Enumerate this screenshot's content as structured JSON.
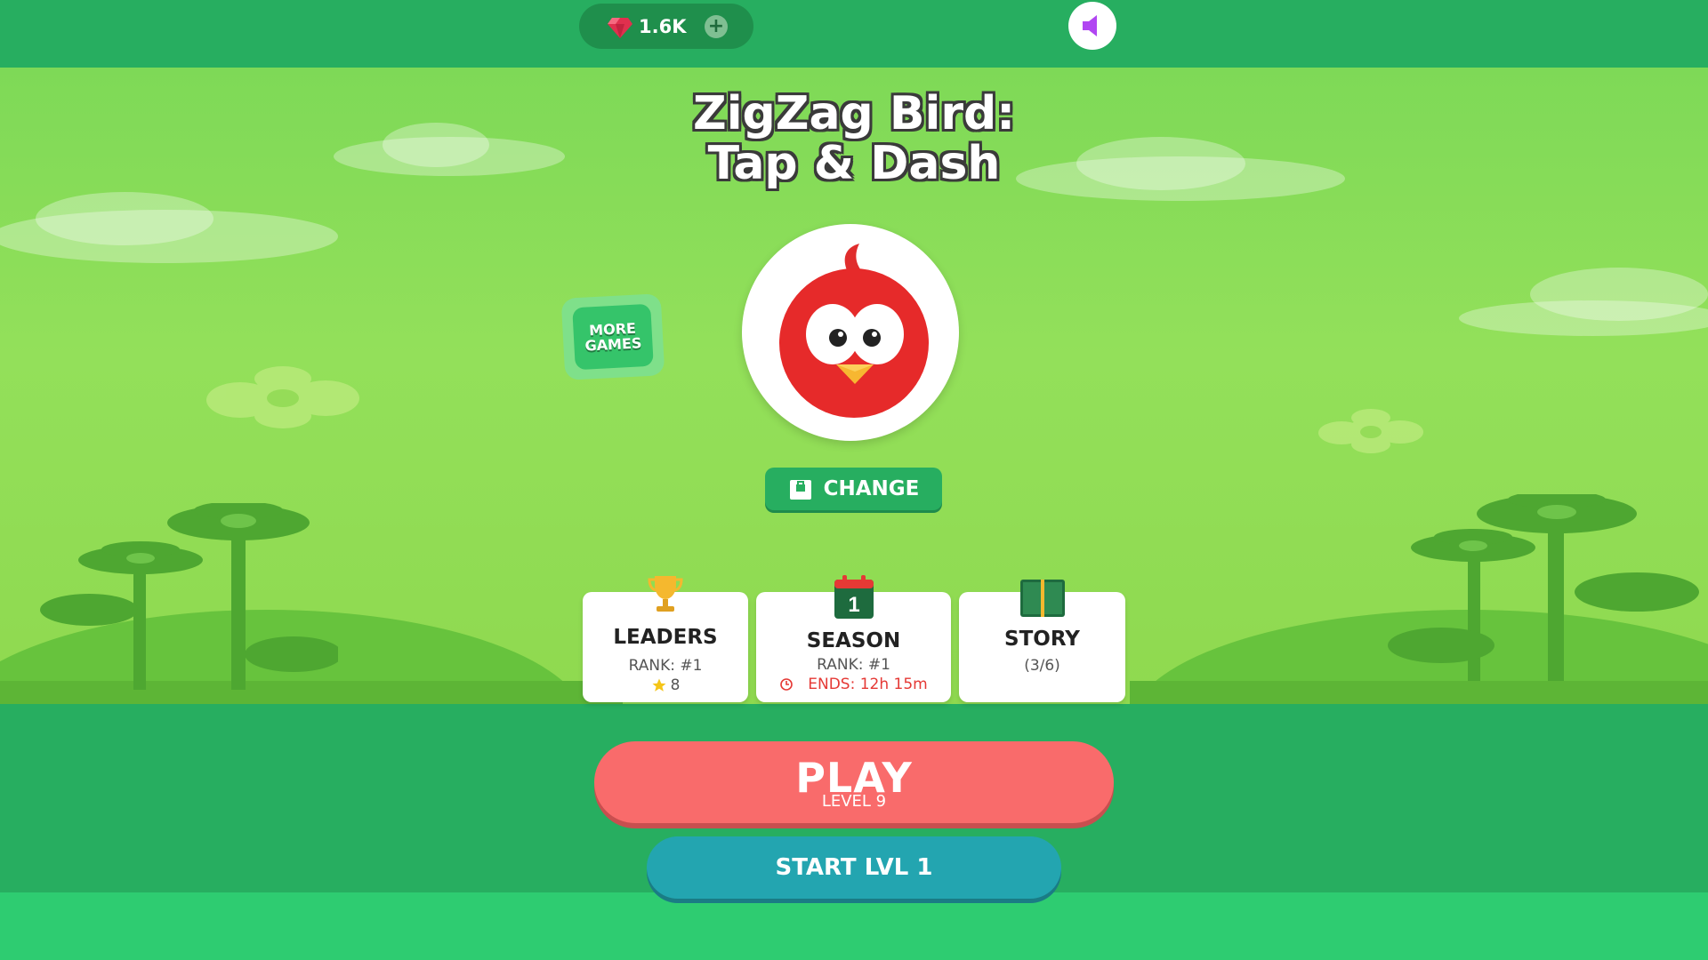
{
  "header": {
    "gems": "1.6K",
    "add_gems_symbol": "+"
  },
  "game": {
    "title_line1": "ZigZag Bird:",
    "title_line2": "Tap & Dash"
  },
  "more_games": {
    "line1": "MORE",
    "line2": "GAMES"
  },
  "change_button": {
    "label": "CHANGE"
  },
  "cards": {
    "leaders": {
      "title": "LEADERS",
      "rank": "RANK: #1",
      "stars": "8"
    },
    "season": {
      "day": "1",
      "title": "SEASON",
      "rank": "RANK: #1",
      "ends": "ENDS: 12h 15m"
    },
    "story": {
      "title": "STORY",
      "progress": "(3/6)"
    }
  },
  "play_button": {
    "label": "PLAY",
    "level": "LEVEL 9"
  },
  "start_button": {
    "label": "START LVL 1"
  },
  "colors": {
    "primary_green": "#27ae60",
    "play_red": "#f96b6b",
    "start_teal": "#23a5b0",
    "sound_icon": "#b146f2",
    "season_red": "#e53935"
  },
  "icons": [
    "gem-icon",
    "plus-icon",
    "speaker-icon",
    "bird-avatar",
    "shop-icon",
    "trophy-icon",
    "star-icon",
    "calendar-icon",
    "clock-icon",
    "book-icon"
  ]
}
